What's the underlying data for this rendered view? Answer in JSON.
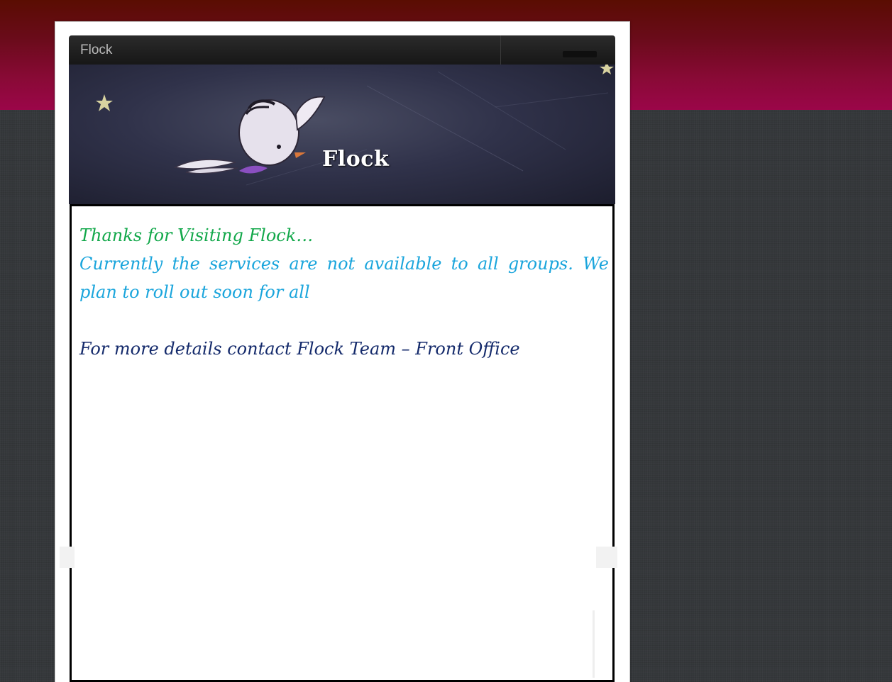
{
  "app_bar": {
    "title": "Flock"
  },
  "banner": {
    "title": "Flock",
    "image": "bird-flying-night-sky"
  },
  "content": {
    "thanks_line": "Thanks for Visiting Flock…",
    "services_line": "Currently the services are not available to all groups. We plan to roll out soon for all",
    "contact_line": "For more details contact Flock Team – Front Office"
  },
  "colors": {
    "header_gradient_top": "#5a0d02",
    "header_gradient_bottom": "#9b0649",
    "background": "#35383b",
    "thanks_text": "#12a84a",
    "services_text": "#1aa5dc",
    "contact_text": "#142a6b"
  }
}
